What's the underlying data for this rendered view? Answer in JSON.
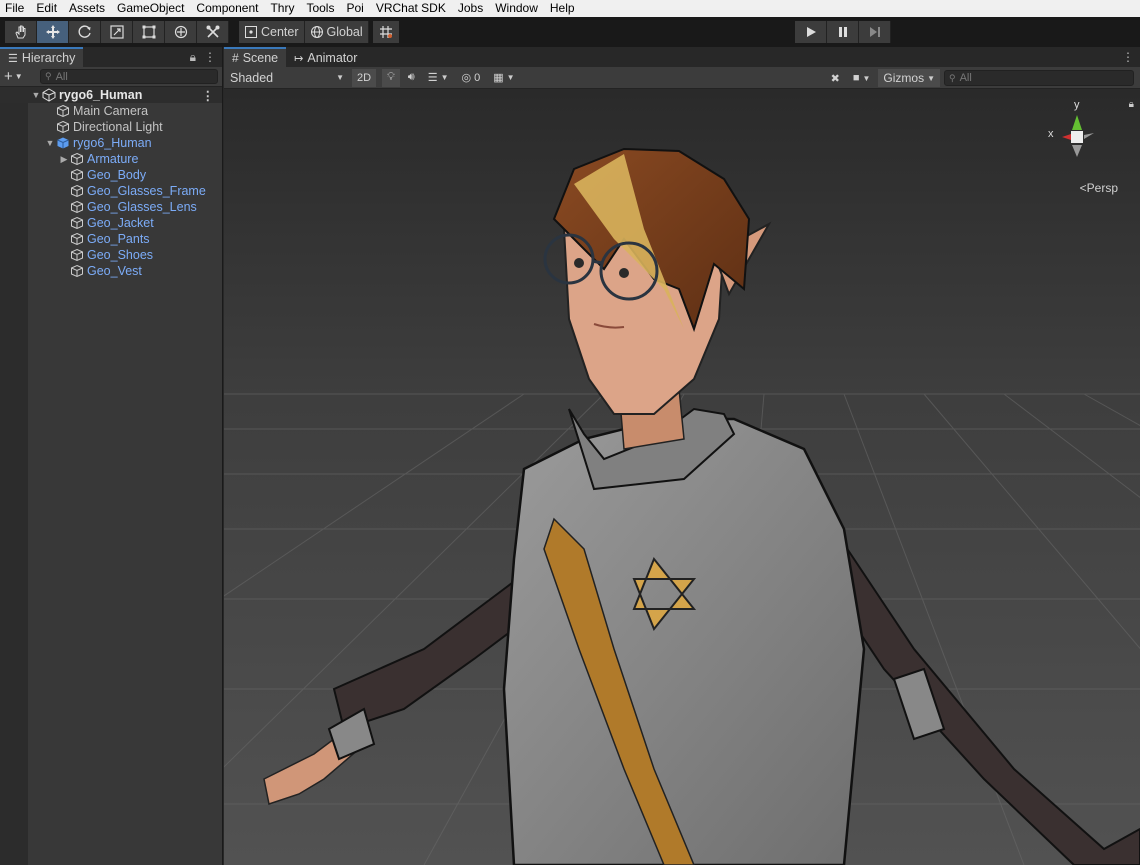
{
  "menu": [
    "File",
    "Edit",
    "Assets",
    "GameObject",
    "Component",
    "Thry",
    "Tools",
    "Poi",
    "VRChat SDK",
    "Jobs",
    "Window",
    "Help"
  ],
  "toolbar": {
    "tools": [
      "hand-tool",
      "move-tool",
      "rotate-tool",
      "scale-tool",
      "rect-tool",
      "transform-tool",
      "custom-tool"
    ],
    "active_tool": "move-tool",
    "pivot_mode": "Center",
    "pivot_rotation": "Global"
  },
  "hierarchy": {
    "tab_label": "Hierarchy",
    "search_placeholder": "All",
    "scene_name": "rygo6_Human",
    "items": [
      {
        "label": "Main Camera"
      },
      {
        "label": "Directional Light"
      },
      {
        "label": "rygo6_Human"
      },
      {
        "label": "Armature"
      },
      {
        "label": "Geo_Body"
      },
      {
        "label": "Geo_Glasses_Frame"
      },
      {
        "label": "Geo_Glasses_Lens"
      },
      {
        "label": "Geo_Jacket"
      },
      {
        "label": "Geo_Pants"
      },
      {
        "label": "Geo_Shoes"
      },
      {
        "label": "Geo_Vest"
      }
    ]
  },
  "scene": {
    "tabs": [
      "Scene",
      "Animator"
    ],
    "shading_mode": "Shaded",
    "mode_2d": "2D",
    "hidden_count": "0",
    "gizmos_label": "Gizmos",
    "search_placeholder": "All",
    "projection_label": "Persp",
    "axis_y": "y",
    "axis_x": "x"
  },
  "colors": {
    "accent": "#3a79bb",
    "prefab_blue": "#7cacf8",
    "active_tool": "#46607c"
  }
}
